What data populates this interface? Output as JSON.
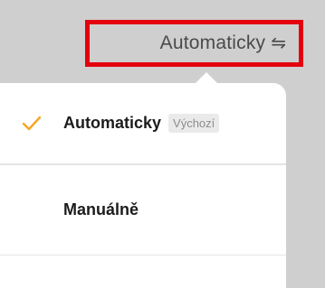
{
  "header": {
    "sort_label": "Automaticky",
    "sort_icon": "swap-arrows-icon",
    "sort_icon_glyph": "⇋",
    "highlight_color": "#e3000f"
  },
  "dropdown": {
    "options": [
      {
        "label": "Automaticky",
        "badge": "Výchozí",
        "selected": true,
        "check_icon": "checkmark-icon"
      },
      {
        "label": "Manuálně",
        "selected": false
      }
    ]
  },
  "colors": {
    "accent": "#f5a623",
    "background": "#cfcfcf",
    "panel": "#ffffff"
  }
}
